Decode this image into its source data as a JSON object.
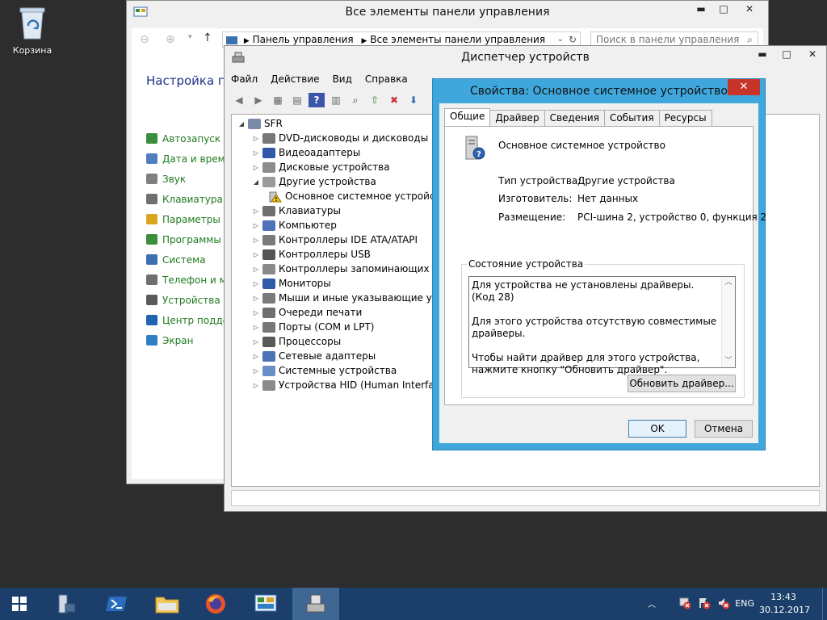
{
  "desktop": {
    "recycle_bin_label": "Корзина"
  },
  "control_panel": {
    "title": "Все элементы панели управления",
    "address": {
      "crumb1": "Панель управления",
      "crumb2": "Все элементы панели управления"
    },
    "search_placeholder": "Поиск в панели управления",
    "heading": "Настройка па",
    "items": [
      {
        "label": "Автозапуск",
        "color": "#3b8e3b"
      },
      {
        "label": "Дата и время",
        "color": "#4f7fbf"
      },
      {
        "label": "Звук",
        "color": "#808080"
      },
      {
        "label": "Клавиатура",
        "color": "#6f6f6f"
      },
      {
        "label": "Параметры па",
        "color": "#d9a520"
      },
      {
        "label": "Программы и",
        "color": "#3b8e3b"
      },
      {
        "label": "Система",
        "color": "#3b6fb0"
      },
      {
        "label": "Телефон и мо",
        "color": "#6f6f6f"
      },
      {
        "label": "Устройства и",
        "color": "#5a5a5a"
      },
      {
        "label": "Центр поддер",
        "color": "#1e63b0"
      },
      {
        "label": "Экран",
        "color": "#2f7fc6"
      }
    ]
  },
  "device_manager": {
    "title": "Диспетчер устройств",
    "menu": [
      "Файл",
      "Действие",
      "Вид",
      "Справка"
    ],
    "root": "SFR",
    "nodes": [
      {
        "label": "DVD-дисководы и дисководы ком",
        "expander": "▷",
        "color": "#777777"
      },
      {
        "label": "Видеоадаптеры",
        "expander": "▷",
        "color": "#2f5aa8"
      },
      {
        "label": "Дисковые устройства",
        "expander": "▷",
        "color": "#8c8c8c"
      },
      {
        "label": "Другие устройства",
        "expander": "◢",
        "color": "#9a9a9a"
      },
      {
        "label": "Клавиатуры",
        "expander": "▷",
        "color": "#6f6f6f"
      },
      {
        "label": "Компьютер",
        "expander": "▷",
        "color": "#4c72b8"
      },
      {
        "label": "Контроллеры IDE ATA/ATAPI",
        "expander": "▷",
        "color": "#7a7a7a"
      },
      {
        "label": "Контроллеры USB",
        "expander": "▷",
        "color": "#555555"
      },
      {
        "label": "Контроллеры запоминающих уст",
        "expander": "▷",
        "color": "#8a8a8a"
      },
      {
        "label": "Мониторы",
        "expander": "▷",
        "color": "#2f5aa8"
      },
      {
        "label": "Мыши и иные указывающие устр",
        "expander": "▷",
        "color": "#7a7a7a"
      },
      {
        "label": "Очереди печати",
        "expander": "▷",
        "color": "#6f6f6f"
      },
      {
        "label": "Порты (COM и LPT)",
        "expander": "▷",
        "color": "#777777"
      },
      {
        "label": "Процессоры",
        "expander": "▷",
        "color": "#5a5a5a"
      },
      {
        "label": "Сетевые адаптеры",
        "expander": "▷",
        "color": "#4c72b8"
      },
      {
        "label": "Системные устройства",
        "expander": "▷",
        "color": "#6a8fc8"
      },
      {
        "label": "Устройства HID (Human Interface",
        "expander": "▷",
        "color": "#8a8a8a"
      }
    ],
    "child_node": "Основное системное устройст"
  },
  "properties": {
    "title": "Свойства: Основное системное устройство",
    "tabs": [
      "Общие",
      "Драйвер",
      "Сведения",
      "События",
      "Ресурсы"
    ],
    "device_name": "Основное системное устройство",
    "type_label": "Тип устройства:",
    "type_value": "Другие устройства",
    "manufacturer_label": "Изготовитель:",
    "manufacturer_value": "Нет данных",
    "location_label": "Размещение:",
    "location_value": "PCI-шина 2, устройство 0, функция 2",
    "status_group_label": "Состояние устройства",
    "status_line1": "Для устройства не установлены драйверы. (Код 28)",
    "status_line2": "Для этого устройства отсутствую совместимые драйверы.",
    "status_line3": "Чтобы найти драйвер для этого устройства, нажмите кнопку \"Обновить драйвер\".",
    "update_button": "Обновить драйвер...",
    "ok_button": "OK",
    "cancel_button": "Отмена"
  },
  "taskbar": {
    "lang": "ENG",
    "time": "13:43",
    "date": "30.12.2017"
  }
}
